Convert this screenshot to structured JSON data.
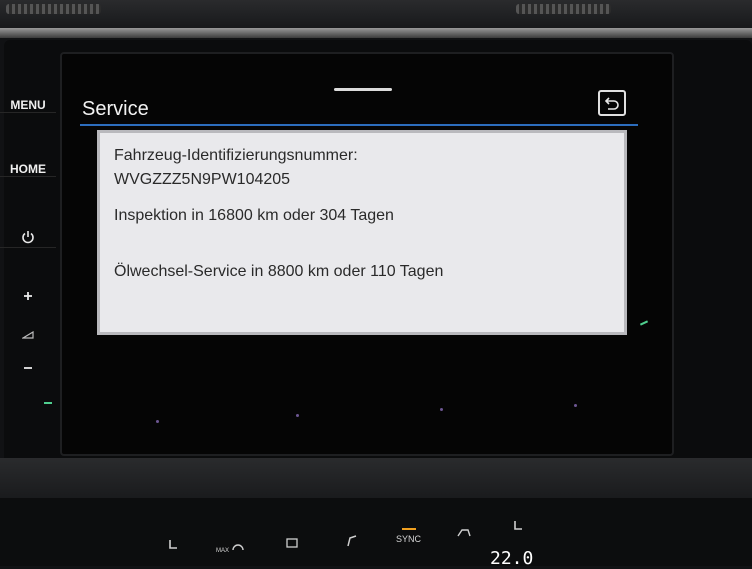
{
  "side_menu": {
    "menu_label": "MENU",
    "home_label": "HOME"
  },
  "screen": {
    "title": "Service",
    "back_icon": "back-arrow-icon",
    "info": {
      "vin_label": "Fahrzeug-Identifizierungsnummer:",
      "vin_value": "WVGZZZ5N9PW104205",
      "inspection": "Inspektion in 16800 km oder 304 Tagen",
      "oil_service": "Ölwechsel-Service in 8800 km oder 110 Tagen"
    }
  },
  "climate": {
    "max_label": "MAX",
    "sync_label": "SYNC",
    "temperature": "22.0"
  },
  "colors": {
    "accent_rule": "#2c6dbd",
    "panel_bg": "#e9e9ec"
  }
}
